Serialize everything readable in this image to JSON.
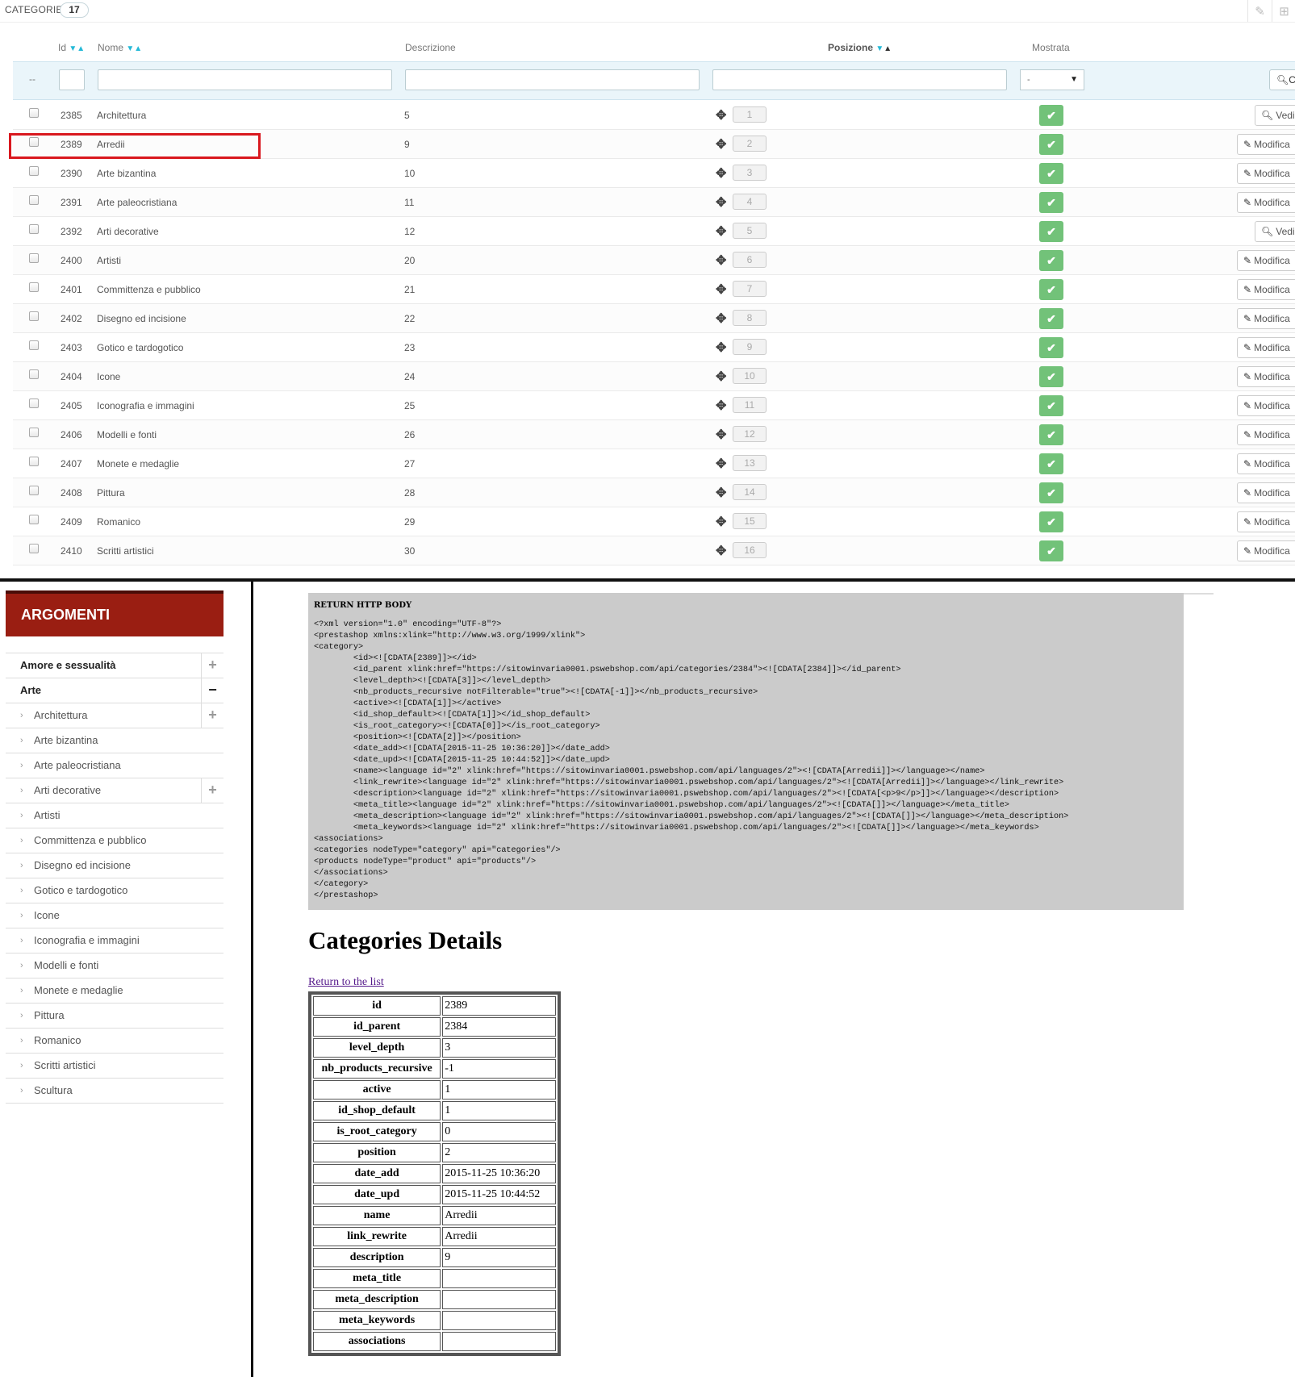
{
  "admin": {
    "panel_title": "CATEGORIE",
    "count": "17",
    "columns": {
      "id": "Id",
      "name": "Nome",
      "description": "Descrizione",
      "position": "Posizione",
      "shown": "Mostrata"
    },
    "filter": {
      "dash": "--",
      "select_value": "-",
      "search_label": "C"
    },
    "edit_label": "Modifica",
    "view_label": "Vedi",
    "rows": [
      {
        "id": "2385",
        "name": "Architettura",
        "desc": "5",
        "pos": "1",
        "action": "Vedi"
      },
      {
        "id": "2389",
        "name": "Arredii",
        "desc": "9",
        "pos": "2",
        "action": "Modifica"
      },
      {
        "id": "2390",
        "name": "Arte bizantina",
        "desc": "10",
        "pos": "3",
        "action": "Modifica"
      },
      {
        "id": "2391",
        "name": "Arte paleocristiana",
        "desc": "11",
        "pos": "4",
        "action": "Modifica"
      },
      {
        "id": "2392",
        "name": "Arti decorative",
        "desc": "12",
        "pos": "5",
        "action": "Vedi"
      },
      {
        "id": "2400",
        "name": "Artisti",
        "desc": "20",
        "pos": "6",
        "action": "Modifica"
      },
      {
        "id": "2401",
        "name": "Committenza e pubblico",
        "desc": "21",
        "pos": "7",
        "action": "Modifica"
      },
      {
        "id": "2402",
        "name": "Disegno ed incisione",
        "desc": "22",
        "pos": "8",
        "action": "Modifica"
      },
      {
        "id": "2403",
        "name": "Gotico e tardogotico",
        "desc": "23",
        "pos": "9",
        "action": "Modifica"
      },
      {
        "id": "2404",
        "name": "Icone",
        "desc": "24",
        "pos": "10",
        "action": "Modifica"
      },
      {
        "id": "2405",
        "name": "Iconografia e immagini",
        "desc": "25",
        "pos": "11",
        "action": "Modifica"
      },
      {
        "id": "2406",
        "name": "Modelli e fonti",
        "desc": "26",
        "pos": "12",
        "action": "Modifica"
      },
      {
        "id": "2407",
        "name": "Monete e medaglie",
        "desc": "27",
        "pos": "13",
        "action": "Modifica"
      },
      {
        "id": "2408",
        "name": "Pittura",
        "desc": "28",
        "pos": "14",
        "action": "Modifica"
      },
      {
        "id": "2409",
        "name": "Romanico",
        "desc": "29",
        "pos": "15",
        "action": "Modifica"
      },
      {
        "id": "2410",
        "name": "Scritti artistici",
        "desc": "30",
        "pos": "16",
        "action": "Modifica"
      }
    ],
    "colors": {
      "accent": "#25b9d7",
      "shown_green": "#72c279",
      "highlight": "#d9181e"
    }
  },
  "sidebar": {
    "title": "ARGOMENTI",
    "color": "#9a1e12",
    "items": [
      {
        "label": "Amore e sessualità",
        "level": "top",
        "toggle": "+"
      },
      {
        "label": "Arte",
        "level": "top",
        "toggle": "−"
      },
      {
        "label": "Architettura",
        "level": "sub",
        "toggle": "+"
      },
      {
        "label": "Arte bizantina",
        "level": "sub",
        "toggle": ""
      },
      {
        "label": "Arte paleocristiana",
        "level": "sub",
        "toggle": ""
      },
      {
        "label": "Arti decorative",
        "level": "sub",
        "toggle": "+"
      },
      {
        "label": "Artisti",
        "level": "sub",
        "toggle": ""
      },
      {
        "label": "Committenza e pubblico",
        "level": "sub",
        "toggle": ""
      },
      {
        "label": "Disegno ed incisione",
        "level": "sub",
        "toggle": ""
      },
      {
        "label": "Gotico e tardogotico",
        "level": "sub",
        "toggle": ""
      },
      {
        "label": "Icone",
        "level": "sub",
        "toggle": ""
      },
      {
        "label": "Iconografia e immagini",
        "level": "sub",
        "toggle": ""
      },
      {
        "label": "Modelli e fonti",
        "level": "sub",
        "toggle": ""
      },
      {
        "label": "Monete e medaglie",
        "level": "sub",
        "toggle": ""
      },
      {
        "label": "Pittura",
        "level": "sub",
        "toggle": ""
      },
      {
        "label": "Romanico",
        "level": "sub",
        "toggle": ""
      },
      {
        "label": "Scritti artistici",
        "level": "sub",
        "toggle": ""
      },
      {
        "label": "Scultura",
        "level": "sub",
        "toggle": ""
      }
    ]
  },
  "api": {
    "code_title": "RETURN HTTP BODY",
    "code_lines": [
      "<?xml version=\"1.0\" encoding=\"UTF-8\"?>",
      "<prestashop xmlns:xlink=\"http://www.w3.org/1999/xlink\">",
      "<category>",
      "        <id><![CDATA[2389]]></id>",
      "        <id_parent xlink:href=\"https://sitowinvaria0001.pswebshop.com/api/categories/2384\"><![CDATA[2384]]></id_parent>",
      "        <level_depth><![CDATA[3]]></level_depth>",
      "        <nb_products_recursive notFilterable=\"true\"><![CDATA[-1]]></nb_products_recursive>",
      "        <active><![CDATA[1]]></active>",
      "        <id_shop_default><![CDATA[1]]></id_shop_default>",
      "        <is_root_category><![CDATA[0]]></is_root_category>",
      "        <position><![CDATA[2]]></position>",
      "        <date_add><![CDATA[2015-11-25 10:36:20]]></date_add>",
      "        <date_upd><![CDATA[2015-11-25 10:44:52]]></date_upd>",
      "        <name><language id=\"2\" xlink:href=\"https://sitowinvaria0001.pswebshop.com/api/languages/2\"><![CDATA[Arredii]]></language></name>",
      "        <link_rewrite><language id=\"2\" xlink:href=\"https://sitowinvaria0001.pswebshop.com/api/languages/2\"><![CDATA[Arredii]]></language></link_rewrite>",
      "        <description><language id=\"2\" xlink:href=\"https://sitowinvaria0001.pswebshop.com/api/languages/2\"><![CDATA[<p>9</p>]]></language></description>",
      "        <meta_title><language id=\"2\" xlink:href=\"https://sitowinvaria0001.pswebshop.com/api/languages/2\"><![CDATA[]]></language></meta_title>",
      "        <meta_description><language id=\"2\" xlink:href=\"https://sitowinvaria0001.pswebshop.com/api/languages/2\"><![CDATA[]]></language></meta_description>",
      "        <meta_keywords><language id=\"2\" xlink:href=\"https://sitowinvaria0001.pswebshop.com/api/languages/2\"><![CDATA[]]></language></meta_keywords>",
      "<associations>",
      "<categories nodeType=\"category\" api=\"categories\"/>",
      "<products nodeType=\"product\" api=\"products\"/>",
      "</associations>",
      "</category>",
      "</prestashop>"
    ],
    "details_title": "Categories Details",
    "return_link": "Return to the list",
    "details": [
      {
        "key": "id",
        "value": "2389"
      },
      {
        "key": "id_parent",
        "value": "2384"
      },
      {
        "key": "level_depth",
        "value": "3"
      },
      {
        "key": "nb_products_recursive",
        "value": "-1"
      },
      {
        "key": "active",
        "value": "1"
      },
      {
        "key": "id_shop_default",
        "value": "1"
      },
      {
        "key": "is_root_category",
        "value": "0"
      },
      {
        "key": "position",
        "value": "2"
      },
      {
        "key": "date_add",
        "value": "2015-11-25 10:36:20"
      },
      {
        "key": "date_upd",
        "value": "2015-11-25 10:44:52"
      },
      {
        "key": "name",
        "value": "Arredii"
      },
      {
        "key": "link_rewrite",
        "value": "Arredii"
      },
      {
        "key": "description",
        "value": "9"
      },
      {
        "key": "meta_title",
        "value": ""
      },
      {
        "key": "meta_description",
        "value": ""
      },
      {
        "key": "meta_keywords",
        "value": ""
      },
      {
        "key": "associations",
        "value": ""
      }
    ]
  }
}
